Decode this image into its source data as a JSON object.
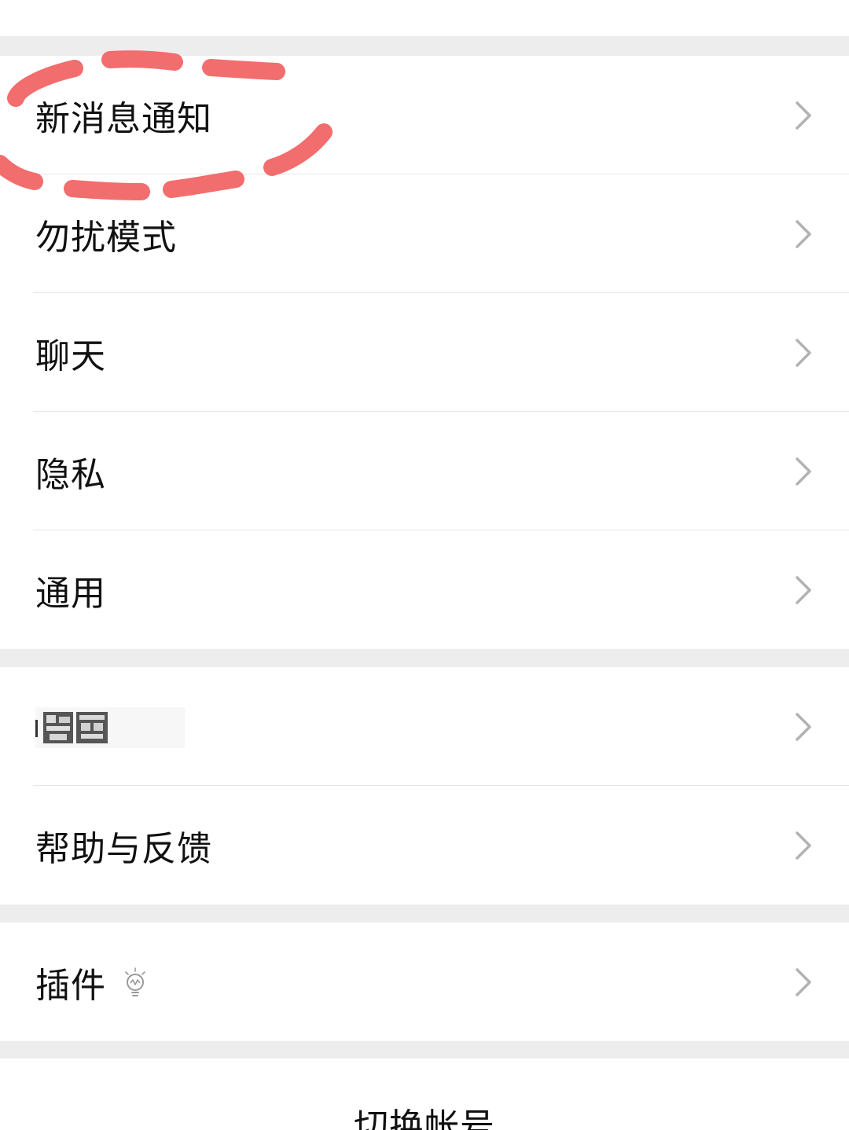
{
  "settings": {
    "group1": [
      {
        "label": "新消息通知"
      },
      {
        "label": "勿扰模式"
      },
      {
        "label": "聊天"
      },
      {
        "label": "隐私"
      },
      {
        "label": "通用"
      }
    ],
    "group2": [
      {
        "label": "",
        "obscured": true
      },
      {
        "label": "帮助与反馈"
      }
    ],
    "group3": [
      {
        "label": "插件",
        "icon": "lightbulb-icon"
      }
    ],
    "switch_account": "切换帐号"
  },
  "annotation": {
    "color": "#f26d6d",
    "target": "新消息通知"
  },
  "colors": {
    "background": "#ededed",
    "cell": "#ffffff",
    "text": "#111111",
    "chevron": "#b2b2b2",
    "divider": "#e5e5e5"
  }
}
